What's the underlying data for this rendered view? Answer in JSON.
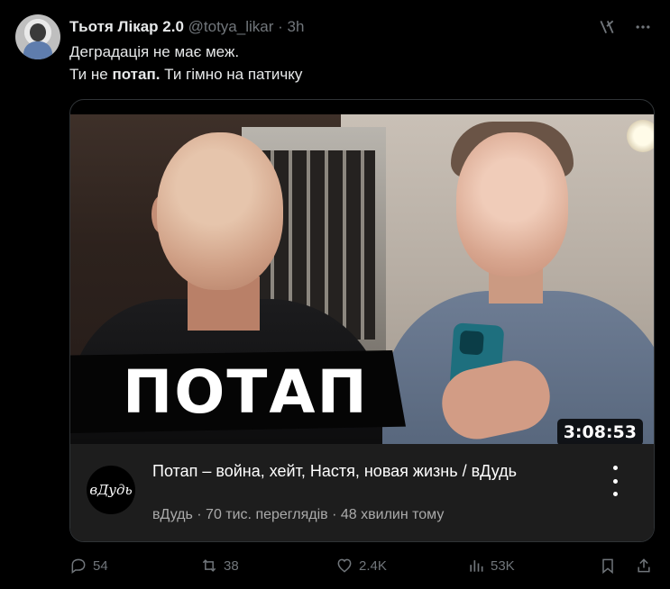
{
  "post": {
    "author_name": "Тьотя Лікар 2.0",
    "handle": "@totya_likar",
    "separator": "·",
    "time": "3h",
    "line1": "Деградація не має меж.",
    "line2_before": "Ти не ",
    "line2_bold": "потап.",
    "line2_after": " Ти гімно на патичку"
  },
  "video": {
    "thumbnail_title": "ПОТАП",
    "duration": "3:08:53",
    "channel_logo_text": "вДудь",
    "title": "Потап – война, хейт, Настя, новая жизнь / вДудь",
    "meta": "вДудь · 70 тис. переглядів · 48 хвилин тому"
  },
  "actions": {
    "replies": "54",
    "reposts": "38",
    "likes": "2.4K",
    "views": "53K"
  },
  "icons": [
    "grok-icon",
    "more-icon",
    "reply-icon",
    "repost-icon",
    "like-icon",
    "views-icon",
    "bookmark-icon",
    "share-icon"
  ],
  "colors": {
    "background": "#000000",
    "text": "#e7e9ea",
    "muted": "#71767b",
    "card_bg": "#1d1d1d"
  }
}
